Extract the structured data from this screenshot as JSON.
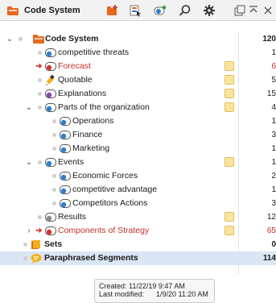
{
  "toolbar": {
    "title": "Code System",
    "icons": [
      "new-code-icon",
      "activate-icon",
      "code-favorites-icon",
      "search-icon",
      "settings-icon",
      "undock-icon",
      "collapse-icon",
      "close-icon"
    ]
  },
  "tree": {
    "rows": [
      {
        "label": "Code System",
        "count": "120",
        "bold": true
      },
      {
        "label": "competitive threats",
        "count": "1"
      },
      {
        "label": "Forecast",
        "count": "6",
        "red": true
      },
      {
        "label": "Quotable",
        "count": "5"
      },
      {
        "label": "Explanations",
        "count": "15"
      },
      {
        "label": "Parts of the organization",
        "count": "4"
      },
      {
        "label": "Operations",
        "count": "1"
      },
      {
        "label": "Finance",
        "count": "3"
      },
      {
        "label": "Marketing",
        "count": "1"
      },
      {
        "label": "Events",
        "count": "1"
      },
      {
        "label": "Economic Forces",
        "count": "2"
      },
      {
        "label": "competitive advantage",
        "count": "1"
      },
      {
        "label": "Competitors Actions",
        "count": "3"
      },
      {
        "label": "Results",
        "count": "12"
      },
      {
        "label": "Components of Strategy",
        "count": "65",
        "red": true
      },
      {
        "label": "Sets",
        "count": "0",
        "bold": true
      },
      {
        "label": "Paraphrased Segments",
        "count": "114",
        "bold": true
      }
    ]
  },
  "tooltip": {
    "created": "Created: 11/22/19 9:47 AM",
    "modified": "Last modified:      1/9/20 11:20 AM"
  },
  "colors": {
    "accent_orange": "#e8681e",
    "code_blue": "#2f7fd1",
    "memo_yellow": "#fbe49e",
    "red_label": "#c0302a",
    "selection": "#dbe6f4"
  }
}
